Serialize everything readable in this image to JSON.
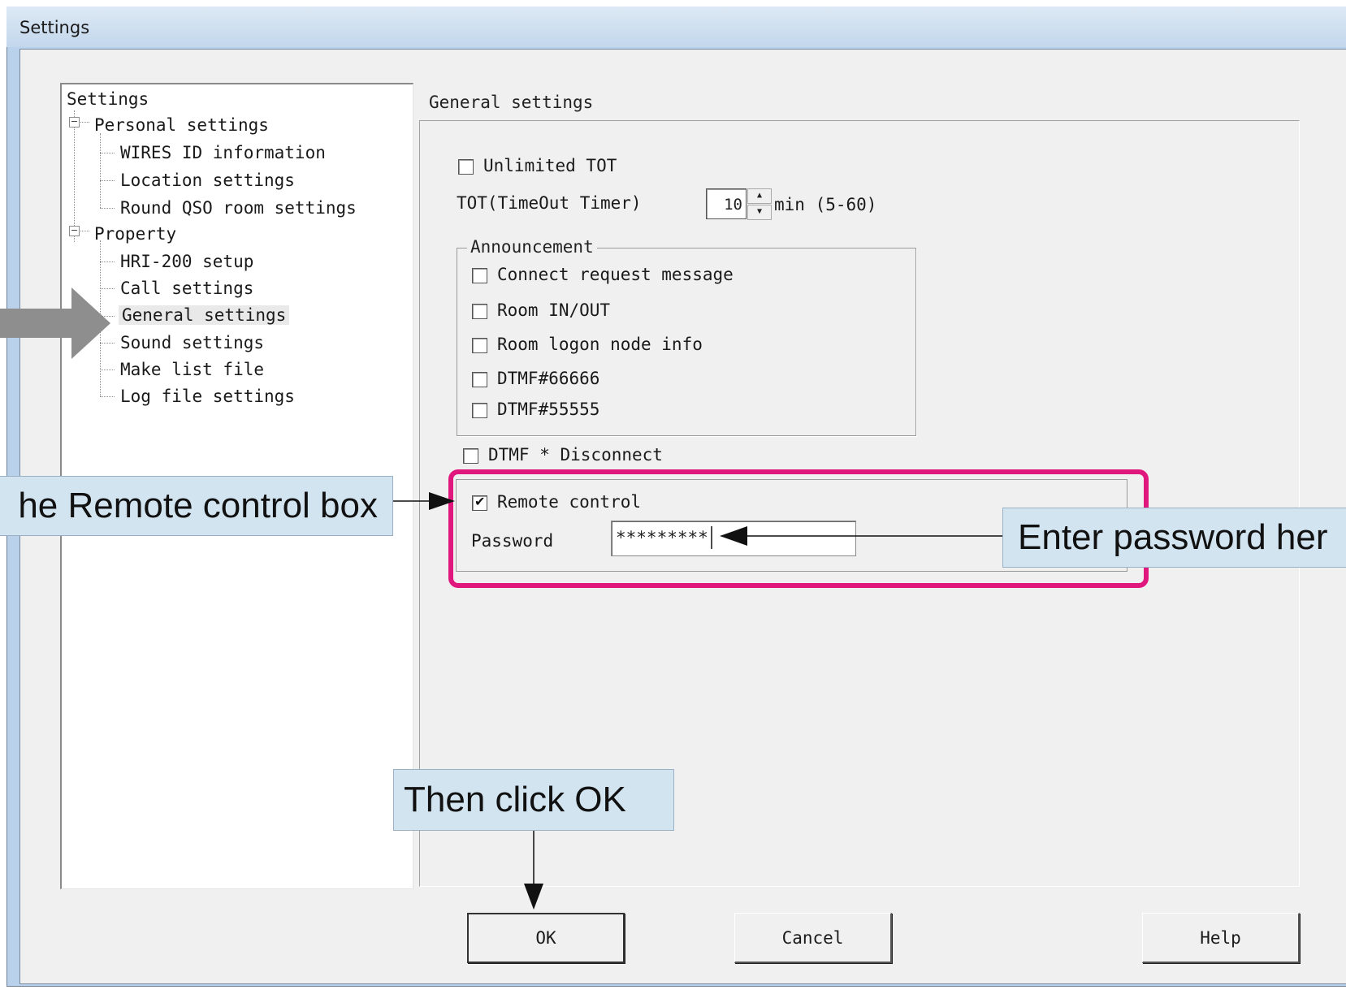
{
  "window": {
    "title": "Settings"
  },
  "tree": {
    "root": "Settings",
    "personal": {
      "label": "Personal settings",
      "children": [
        "WIRES ID information",
        "Location settings",
        "Round QSO room settings"
      ]
    },
    "property": {
      "label": "Property",
      "children": [
        "HRI-200 setup",
        "Call settings",
        "General settings",
        "Sound settings",
        "Make list file",
        "Log file settings"
      ]
    },
    "selected": "General settings"
  },
  "panel": {
    "caption": "General settings",
    "unlimited_tot": {
      "label": "Unlimited TOT",
      "checked": false
    },
    "tot": {
      "label": "TOT(TimeOut Timer)",
      "value": "10",
      "unit": "min (5-60)"
    },
    "announcement": {
      "label": "Announcement",
      "items": [
        {
          "label": "Connect request message",
          "checked": false
        },
        {
          "label": "Room IN/OUT",
          "checked": false
        },
        {
          "label": "Room logon node info",
          "checked": false
        },
        {
          "label": "DTMF#66666",
          "checked": false
        },
        {
          "label": "DTMF#55555",
          "checked": false
        }
      ]
    },
    "dtmf_disconnect": {
      "label": "DTMF * Disconnect",
      "checked": false
    },
    "remote_control": {
      "label": "Remote control",
      "checked": true
    },
    "password": {
      "label": "Password",
      "value": "*********"
    }
  },
  "buttons": {
    "ok": "OK",
    "cancel": "Cancel",
    "help": "Help"
  },
  "callouts": {
    "remote": "he Remote control box",
    "password": "Enter password her",
    "ok": "Then click OK"
  },
  "colors": {
    "highlight": "#e0177d",
    "callout_bg": "#d3e4f1",
    "arrow_gray": "#8e8e8e"
  }
}
